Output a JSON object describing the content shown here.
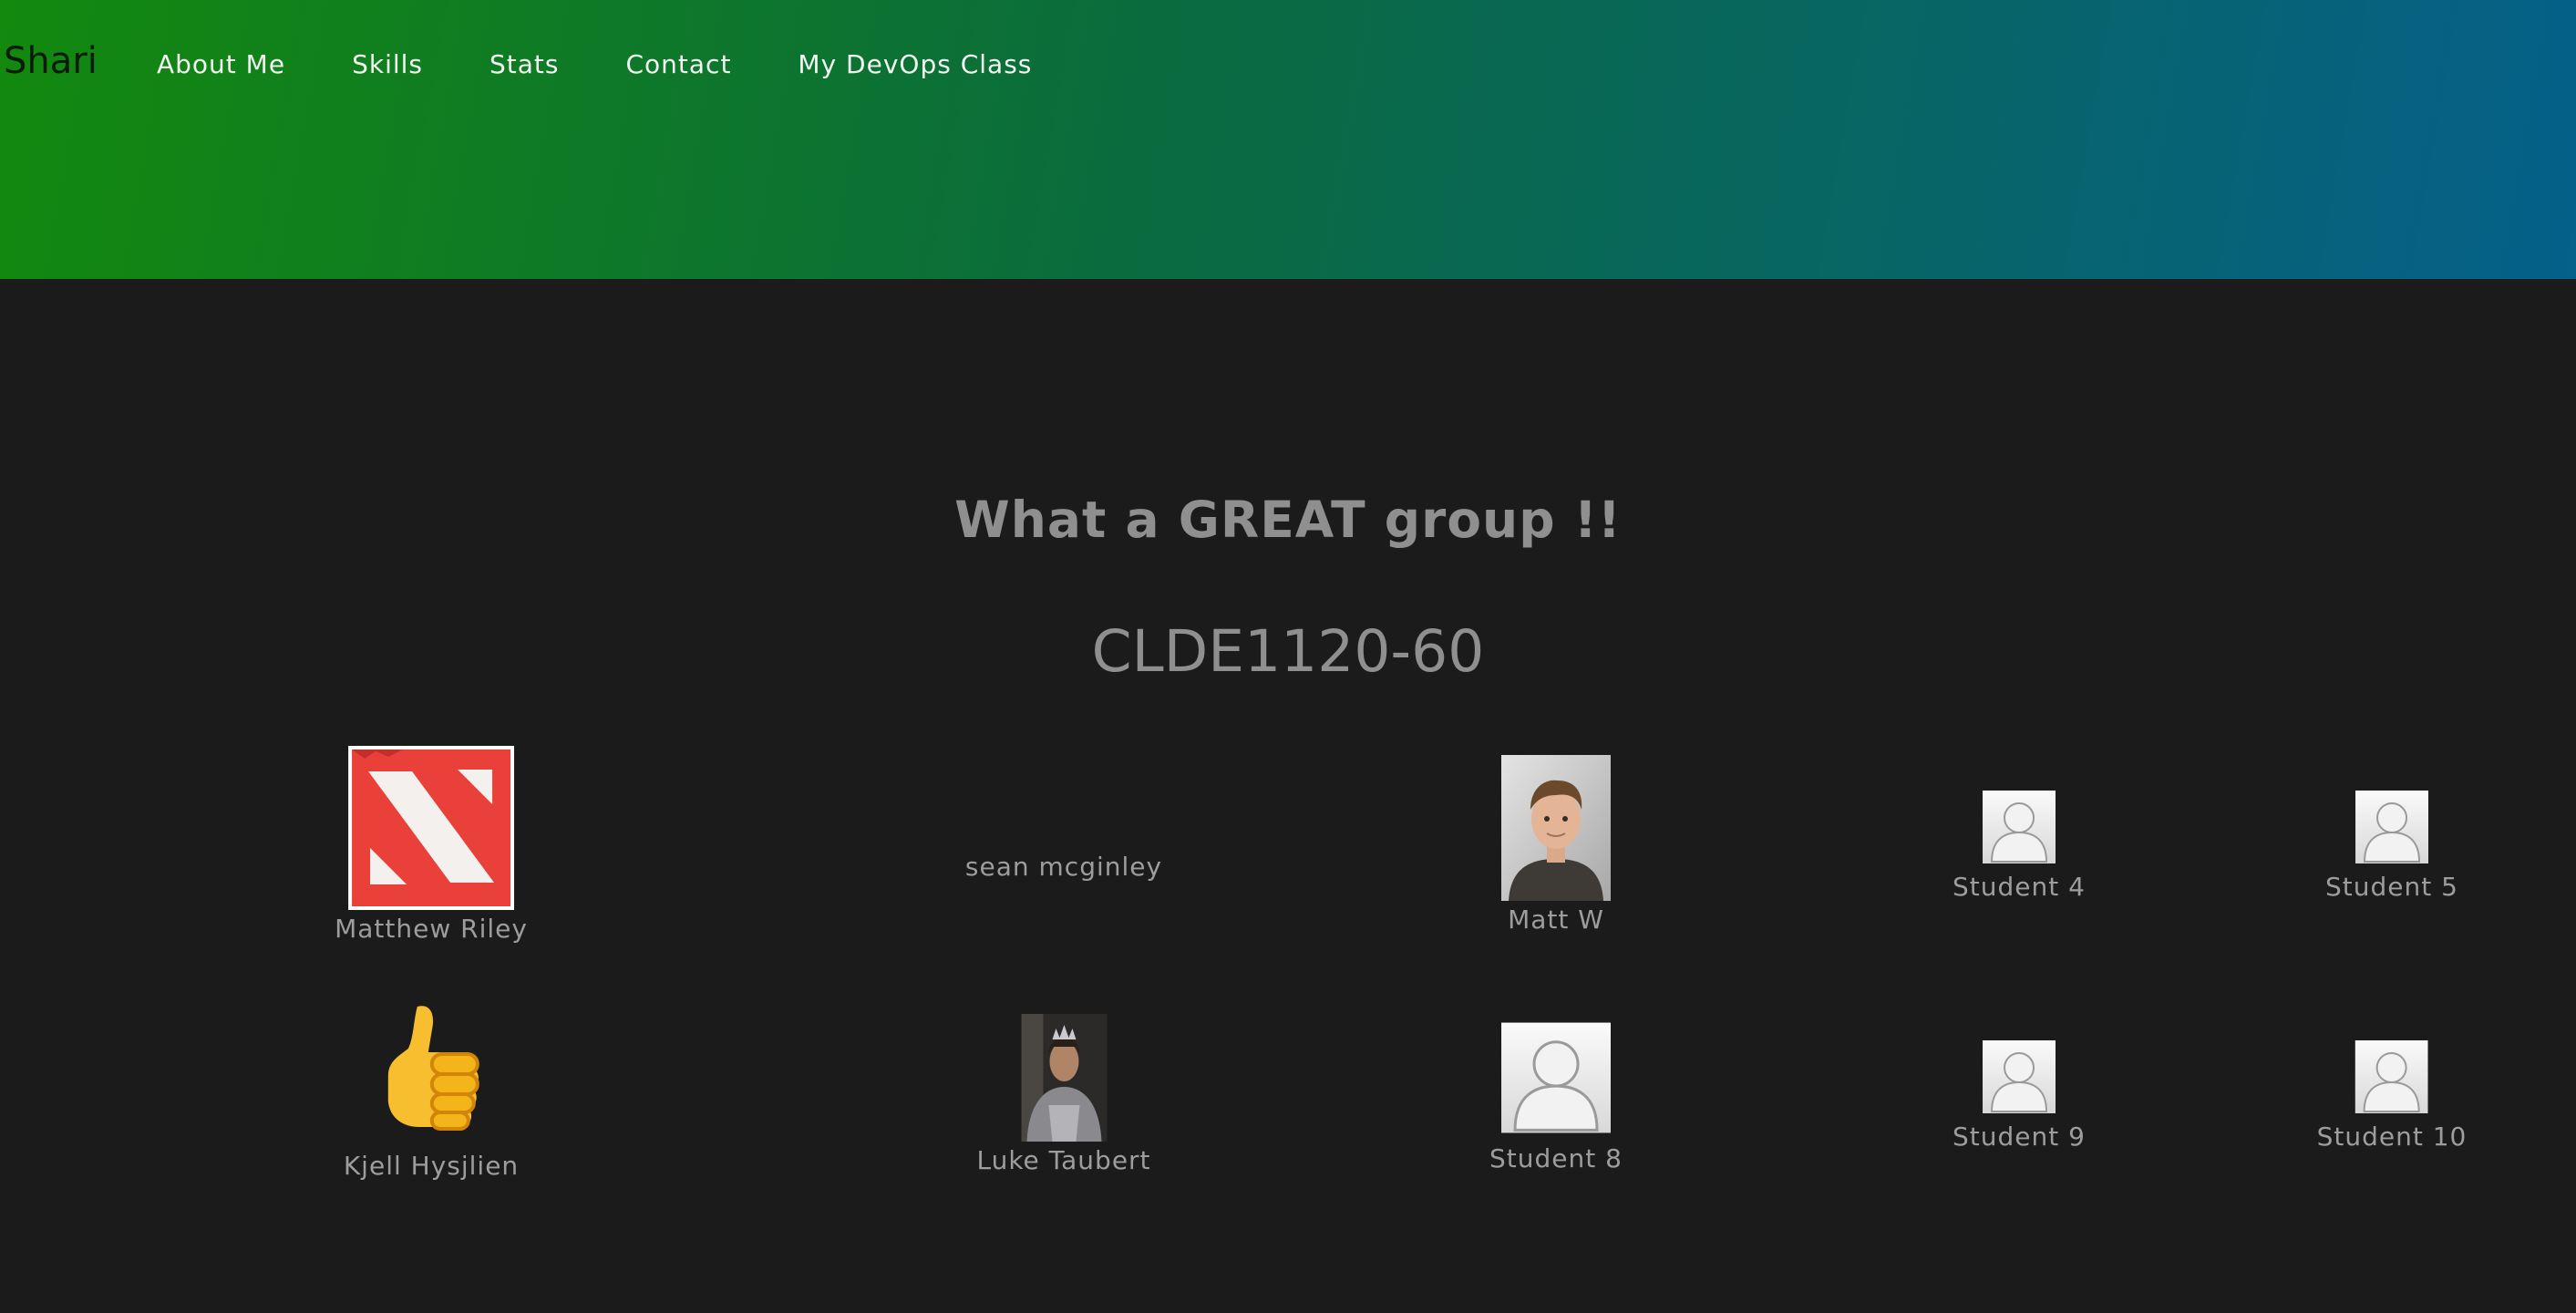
{
  "brand": "Shari",
  "nav": [
    "About Me",
    "Skills",
    "Stats",
    "Contact",
    "My DevOps Class"
  ],
  "headline": "What a GREAT group !!",
  "course": "CLDE1120-60",
  "students": [
    {
      "name": "Matthew Riley",
      "avatar": "red-game-logo"
    },
    {
      "name": "sean mcginley",
      "avatar": "none"
    },
    {
      "name": "Matt W",
      "avatar": "person-photo"
    },
    {
      "name": "Student 4",
      "avatar": "default-user-icon"
    },
    {
      "name": "Student 5",
      "avatar": "default-user-icon"
    },
    {
      "name": "Kjell Hysjlien",
      "avatar": "thumbs-up-emoji"
    },
    {
      "name": "Luke Taubert",
      "avatar": "armored-king-photo"
    },
    {
      "name": "Student 8",
      "avatar": "default-user-icon"
    },
    {
      "name": "Student 9",
      "avatar": "default-user-icon"
    },
    {
      "name": "Student 10",
      "avatar": "default-user-icon"
    }
  ],
  "colors": {
    "header_start": "#13890e",
    "header_end": "#05608a",
    "page_bg": "#1b1b1b",
    "text_muted": "#8f8f8f"
  }
}
